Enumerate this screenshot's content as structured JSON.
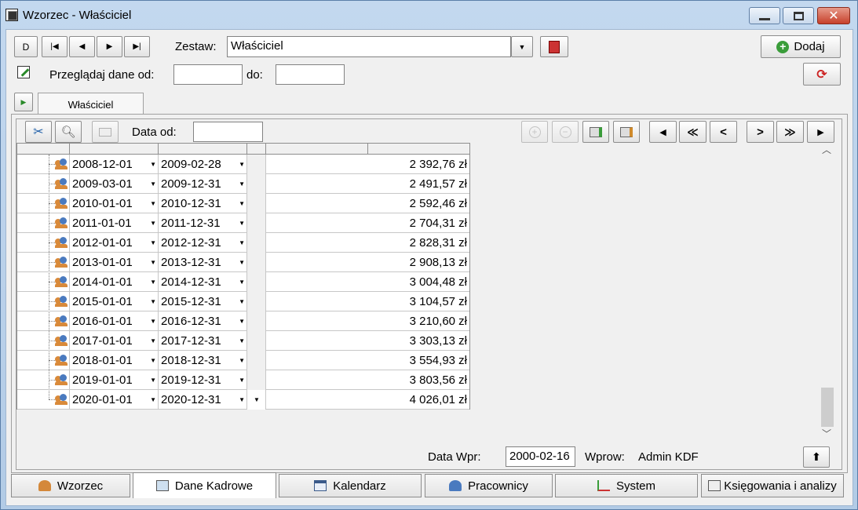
{
  "window": {
    "title": "Wzorzec - Właściciel"
  },
  "toolbar": {
    "nav_buttons": [
      "D",
      "|◀",
      "◀",
      "▶",
      "▶|"
    ],
    "zestaw_label": "Zestaw:",
    "zestaw_value": "Właściciel",
    "add_label": "Dodaj",
    "browse_label": "Przeglądaj dane od:",
    "to_label": "do:"
  },
  "doc_tab": {
    "label": "Właściciel"
  },
  "grid_toolbar": {
    "date_from_label": "Data od:",
    "nav": [
      "◀",
      "≪",
      "<",
      ">",
      "≫",
      "▶"
    ]
  },
  "rows": [
    {
      "from": "2008-12-01",
      "to": "2009-02-28",
      "amount": "2 392,76 zł"
    },
    {
      "from": "2009-03-01",
      "to": "2009-12-31",
      "amount": "2 491,57 zł"
    },
    {
      "from": "2010-01-01",
      "to": "2010-12-31",
      "amount": "2 592,46 zł"
    },
    {
      "from": "2011-01-01",
      "to": "2011-12-31",
      "amount": "2 704,31 zł"
    },
    {
      "from": "2012-01-01",
      "to": "2012-12-31",
      "amount": "2 828,31 zł"
    },
    {
      "from": "2013-01-01",
      "to": "2013-12-31",
      "amount": "2 908,13 zł"
    },
    {
      "from": "2014-01-01",
      "to": "2014-12-31",
      "amount": "3 004,48 zł"
    },
    {
      "from": "2015-01-01",
      "to": "2015-12-31",
      "amount": "3 104,57 zł"
    },
    {
      "from": "2016-01-01",
      "to": "2016-12-31",
      "amount": "3 210,60 zł"
    },
    {
      "from": "2017-01-01",
      "to": "2017-12-31",
      "amount": "3 303,13 zł"
    },
    {
      "from": "2018-01-01",
      "to": "2018-12-31",
      "amount": "3 554,93 zł"
    },
    {
      "from": "2019-01-01",
      "to": "2019-12-31",
      "amount": "3 803,56 zł"
    },
    {
      "from": "2020-01-01",
      "to": "2020-12-31",
      "amount": "4 026,01 zł"
    }
  ],
  "footer": {
    "data_wpr_label": "Data Wpr:",
    "data_wpr_value": "2000-02-16",
    "wprow_label": "Wprow:",
    "wprow_value": "Admin KDF"
  },
  "bottom_tabs": [
    {
      "label": "Wzorzec",
      "icon": "people-icon"
    },
    {
      "label": "Dane Kadrowe",
      "icon": "card-icon"
    },
    {
      "label": "Kalendarz",
      "icon": "calendar-icon"
    },
    {
      "label": "Pracownicy",
      "icon": "person-icon"
    },
    {
      "label": "System",
      "icon": "tree-icon"
    },
    {
      "label": "Księgowania i analizy",
      "icon": "ledger-icon"
    }
  ],
  "colors": {
    "accent": "#2b8a2b",
    "close": "#c7402b",
    "selected_tab": "#ffffff"
  }
}
